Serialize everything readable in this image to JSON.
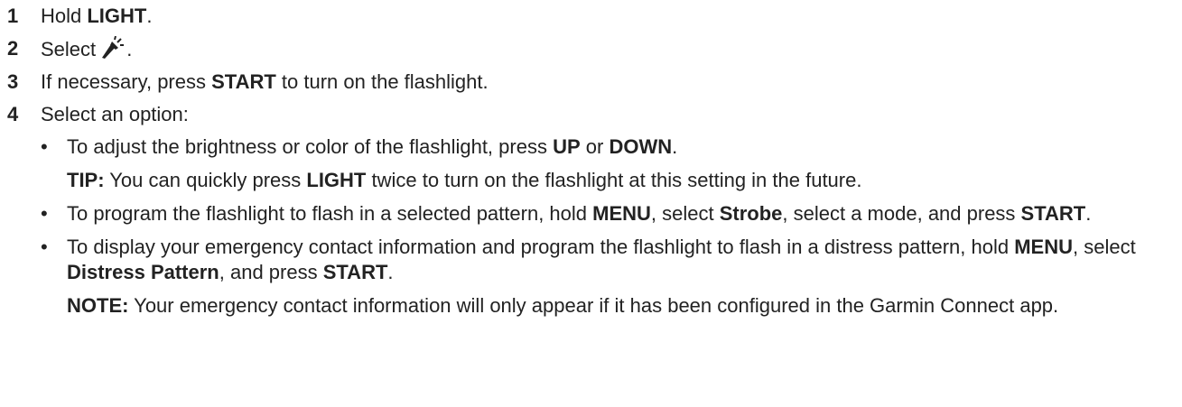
{
  "steps": [
    {
      "number": "1",
      "parts": [
        "Hold ",
        "LIGHT",
        "."
      ]
    },
    {
      "number": "2",
      "parts": [
        "Select ",
        "."
      ],
      "icon": "flashlight-icon"
    },
    {
      "number": "3",
      "parts": [
        "If necessary, press ",
        "START",
        " to turn on the flashlight."
      ]
    },
    {
      "number": "4",
      "parts": [
        "Select an option:"
      ],
      "options": [
        {
          "bullet": "•",
          "parts": [
            "To adjust the brightness or color of the flashlight, press ",
            "UP",
            " or ",
            "DOWN",
            "."
          ],
          "note": {
            "label": "TIP:",
            "text": " You can quickly press ",
            "bold": "LIGHT",
            "tail": " twice to turn on the flashlight at this setting in the future."
          }
        },
        {
          "bullet": "•",
          "parts": [
            "To program the flashlight to flash in a selected pattern, hold ",
            "MENU",
            ", select ",
            "Strobe",
            ", select a mode, and press ",
            "START",
            "."
          ]
        },
        {
          "bullet": "•",
          "parts": [
            "To display your emergency contact information and program the flashlight to flash in a distress pattern, hold ",
            "MENU",
            ", select ",
            "Distress Pattern",
            ", and press ",
            "START",
            "."
          ],
          "note": {
            "label": "NOTE:",
            "text": " Your emergency contact information will only appear if it has been configured in the Garmin Connect app."
          }
        }
      ]
    }
  ],
  "colors": {
    "text": "#222222",
    "background": "#ffffff"
  }
}
